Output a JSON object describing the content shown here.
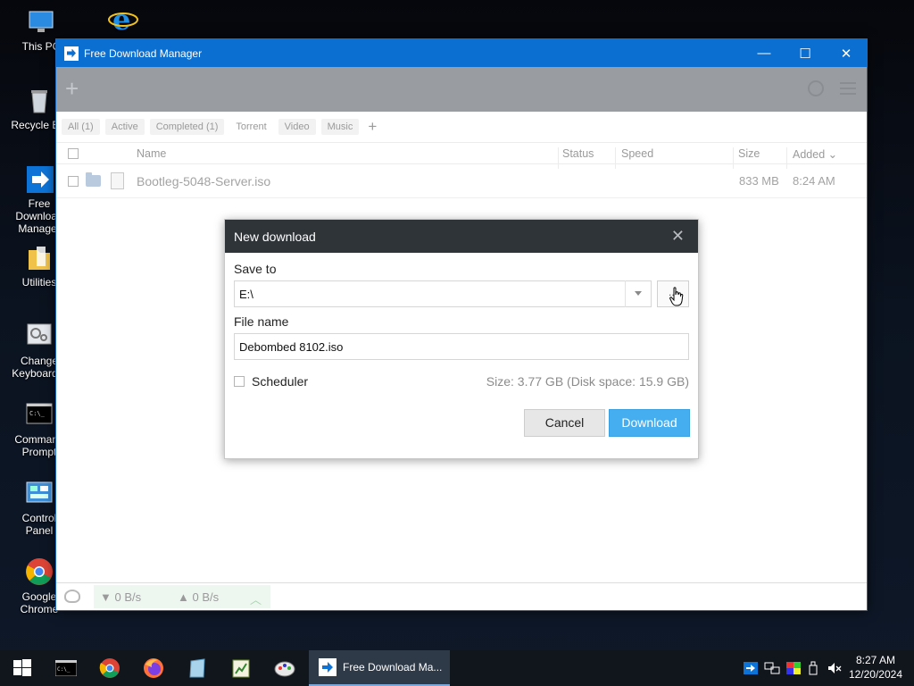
{
  "desktop": {
    "icons": [
      {
        "label": "This PC"
      },
      {
        "label": ""
      },
      {
        "label": "Recycle Bin"
      },
      {
        "label": "Free Download\nManager"
      },
      {
        "label": "Utilities"
      },
      {
        "label": "Change\nKeyboard L"
      },
      {
        "label": "Command\nPrompt"
      },
      {
        "label": "Control Panel"
      },
      {
        "label": "Google Chrome"
      }
    ]
  },
  "window": {
    "title": "Free Download Manager",
    "controls": {
      "minimize": "—",
      "maximize": "☐",
      "close": "✕"
    }
  },
  "filters": [
    {
      "label": "All (1)"
    },
    {
      "label": "Active"
    },
    {
      "label": "Completed (1)"
    },
    {
      "label": "Torrent"
    },
    {
      "label": "Video"
    },
    {
      "label": "Music"
    }
  ],
  "add_filter": "+",
  "table": {
    "columns": {
      "name": "Name",
      "status": "Status",
      "speed": "Speed",
      "size": "Size",
      "added": "Added ⌄"
    },
    "rows": [
      {
        "name": "Bootleg-5048-Server.iso",
        "status": "",
        "speed": "",
        "size": "833 MB",
        "added": "8:24 AM"
      }
    ]
  },
  "statusbar": {
    "down": "▼ 0 B/s",
    "up": "▲ 0 B/s",
    "chevron": "︿"
  },
  "dialog": {
    "title": "New download",
    "close": "✕",
    "save_to_label": "Save to",
    "save_to_value": "E:\\",
    "browse_label": "...",
    "file_name_label": "File name",
    "file_name_value": "Debombed 8102.iso",
    "scheduler_label": "Scheduler",
    "size_info": "Size: 3.77 GB (Disk space: 15.9 GB)",
    "cancel": "Cancel",
    "download": "Download"
  },
  "taskbar": {
    "active_app": "Free Download Ma...",
    "time": "8:27 AM",
    "date": "12/20/2024"
  }
}
